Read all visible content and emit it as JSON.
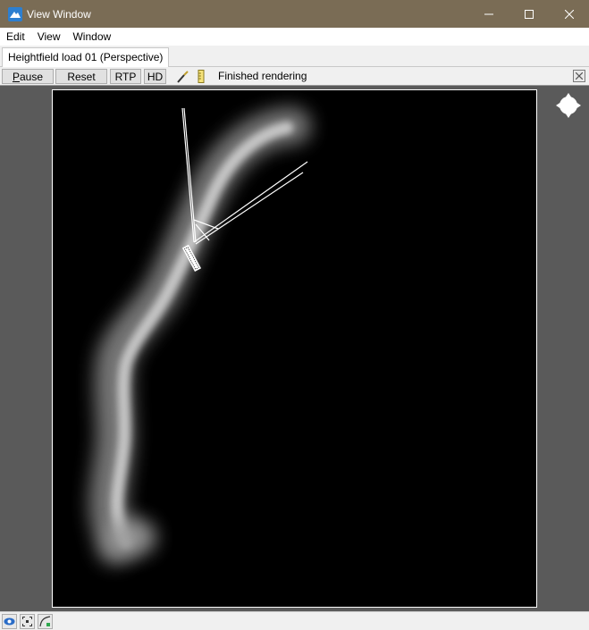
{
  "window": {
    "title": "View Window",
    "accent_color": "#7a6c55"
  },
  "window_controls": {
    "minimize_icon": "minimize-icon",
    "maximize_icon": "maximize-icon",
    "close_icon": "close-icon"
  },
  "menu": {
    "items": [
      {
        "label": "Edit"
      },
      {
        "label": "View"
      },
      {
        "label": "Window"
      }
    ]
  },
  "tab": {
    "label": "Heightfield load 01 (Perspective)"
  },
  "toolbar": {
    "pause_first": "P",
    "pause_rest": "ause",
    "reset_label": "Reset",
    "rtp_label": "RTP",
    "hd_label": "HD",
    "icons": [
      "brush-icon",
      "ruler-icon"
    ],
    "status_text": "Finished rendering",
    "close_icon": "close-icon"
  },
  "viewport": {
    "background": "#000000",
    "navigation_icon": "orbit-navigation-icon"
  },
  "bottom_icons": [
    "eye-icon",
    "frame-icon",
    "curve-icon"
  ]
}
